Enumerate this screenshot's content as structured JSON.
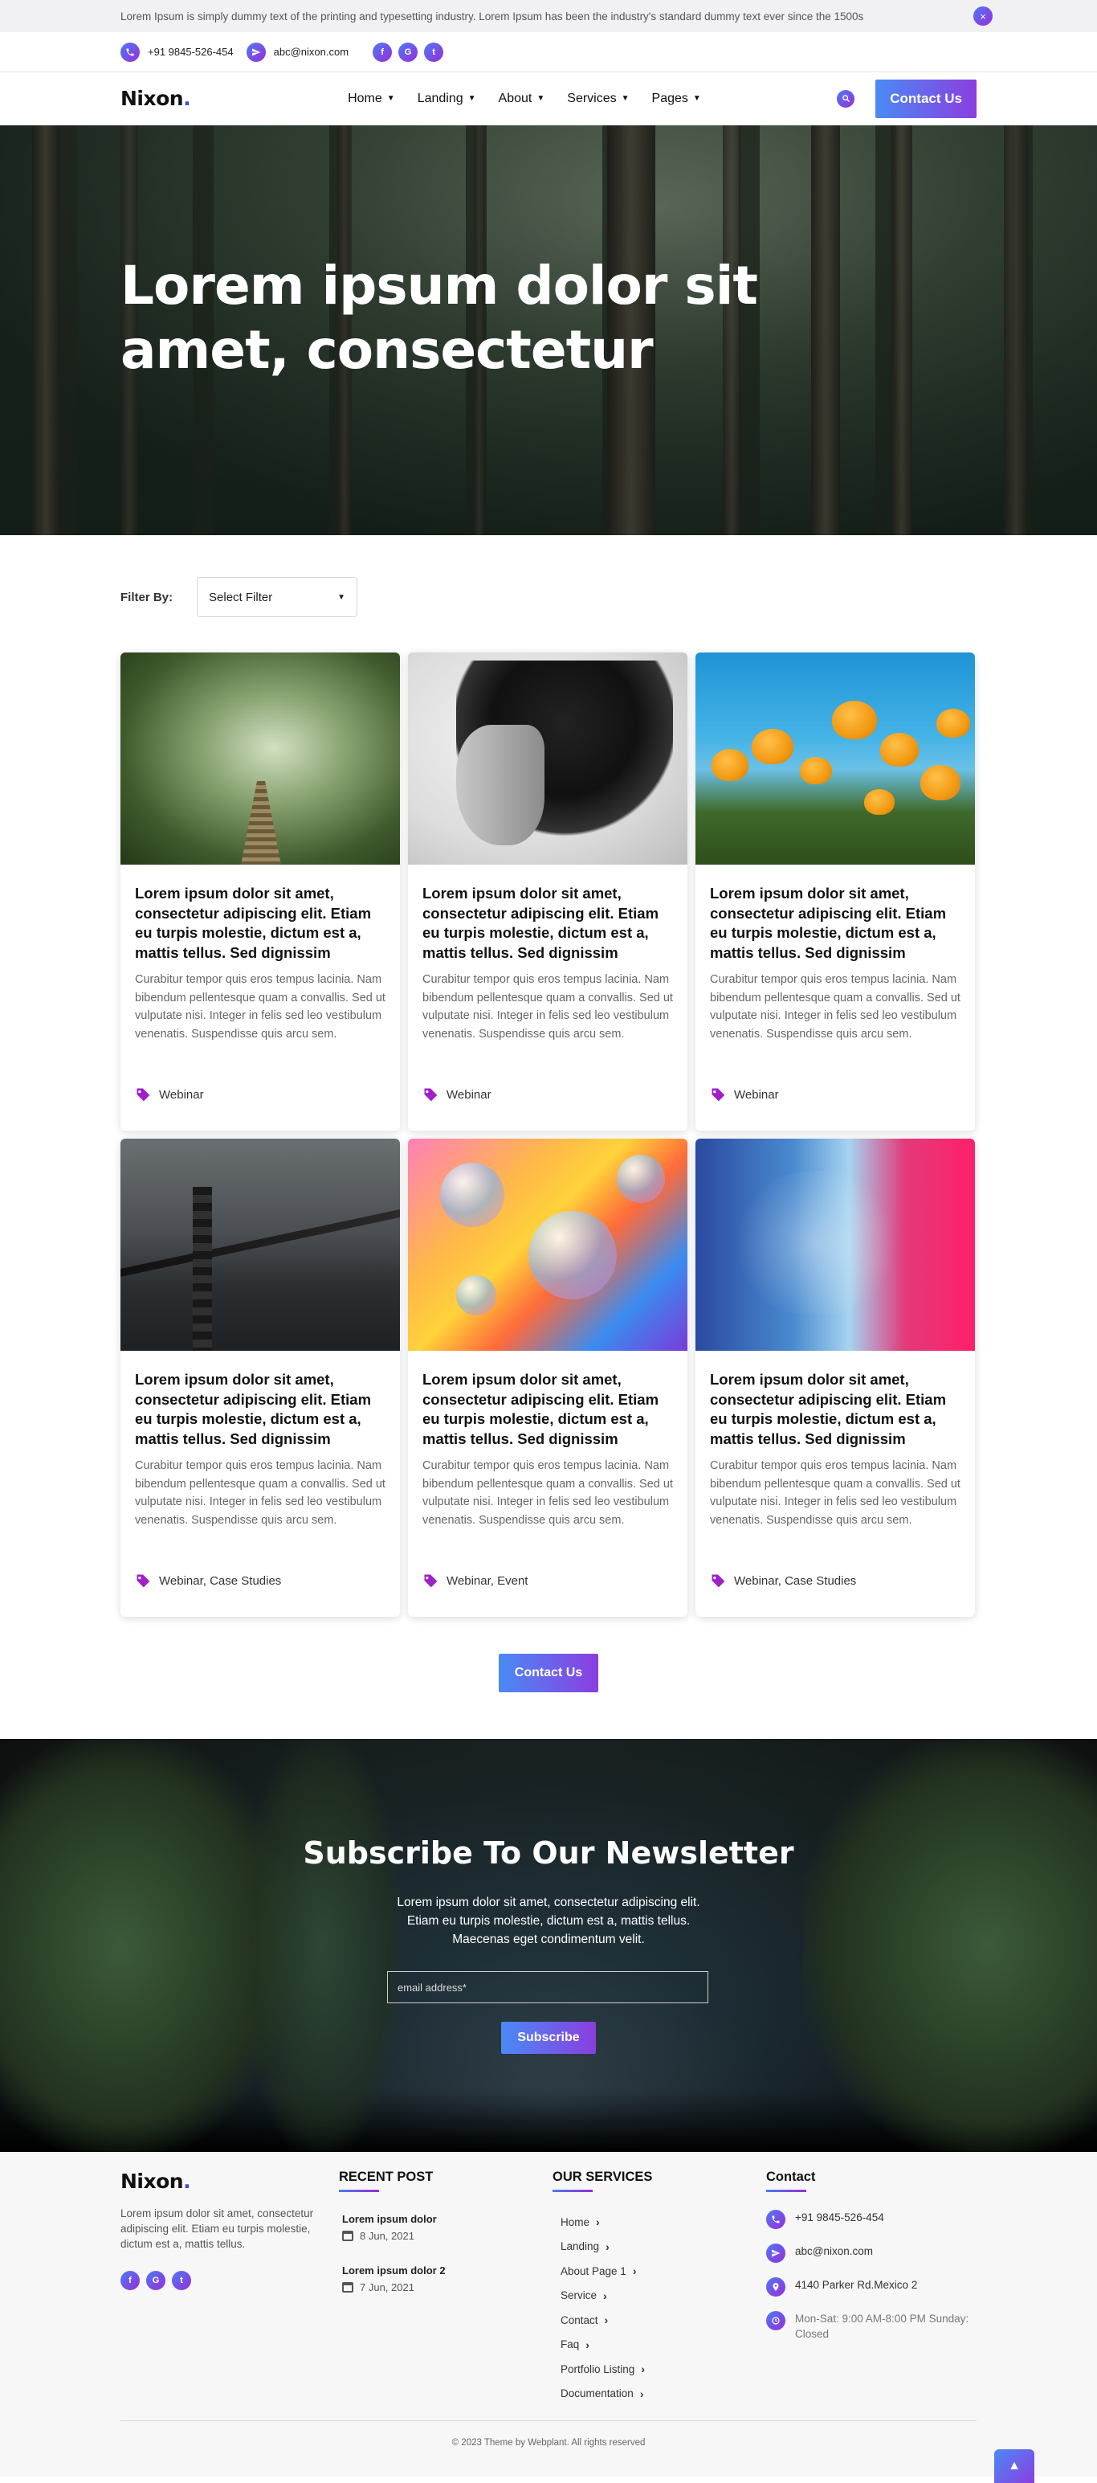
{
  "announcement": {
    "text": "Lorem Ipsum is simply dummy text of the printing and typesetting industry. Lorem Ipsum has been the industry's standard dummy text ever since the 1500s",
    "close_icon": "×"
  },
  "contact_bar": {
    "phone": "+91 9845-526-454",
    "email": "abc@nixon.com",
    "social": [
      "f",
      "G",
      "t"
    ]
  },
  "nav": {
    "logo": "Nixon",
    "logo_dot": ".",
    "items": [
      {
        "label": "Home"
      },
      {
        "label": "Landing"
      },
      {
        "label": "About"
      },
      {
        "label": "Services"
      },
      {
        "label": "Pages"
      }
    ],
    "cta": "Contact Us"
  },
  "hero": {
    "title": "Lorem ipsum dolor sit amet, consectetur"
  },
  "filter": {
    "label": "Filter By:",
    "selected": "Select Filter"
  },
  "cards": [
    {
      "title": "Lorem ipsum dolor sit amet, consectetur adipiscing elit. Etiam eu turpis molestie, dictum est a, mattis tellus. Sed dignissim",
      "text": "Curabitur tempor quis eros tempus lacinia. Nam bibendum pellentesque quam a convallis. Sed ut vulputate nisi. Integer in felis sed leo vestibulum venenatis. Suspendisse quis arcu sem.",
      "tags": "Webinar"
    },
    {
      "title": "Lorem ipsum dolor sit amet, consectetur adipiscing elit. Etiam eu turpis molestie, dictum est a, mattis tellus. Sed dignissim",
      "text": "Curabitur tempor quis eros tempus lacinia. Nam bibendum pellentesque quam a convallis. Sed ut vulputate nisi. Integer in felis sed leo vestibulum venenatis. Suspendisse quis arcu sem.",
      "tags": "Webinar"
    },
    {
      "title": "Lorem ipsum dolor sit amet, consectetur adipiscing elit. Etiam eu turpis molestie, dictum est a, mattis tellus. Sed dignissim",
      "text": "Curabitur tempor quis eros tempus lacinia. Nam bibendum pellentesque quam a convallis. Sed ut vulputate nisi. Integer in felis sed leo vestibulum venenatis. Suspendisse quis arcu sem.",
      "tags": "Webinar"
    },
    {
      "title": "Lorem ipsum dolor sit amet, consectetur adipiscing elit. Etiam eu turpis molestie, dictum est a, mattis tellus. Sed dignissim",
      "text": "Curabitur tempor quis eros tempus lacinia. Nam bibendum pellentesque quam a convallis. Sed ut vulputate nisi. Integer in felis sed leo vestibulum venenatis. Suspendisse quis arcu sem.",
      "tags": "Webinar, Case Studies"
    },
    {
      "title": "Lorem ipsum dolor sit amet, consectetur adipiscing elit. Etiam eu turpis molestie, dictum est a, mattis tellus. Sed dignissim",
      "text": "Curabitur tempor quis eros tempus lacinia. Nam bibendum pellentesque quam a convallis. Sed ut vulputate nisi. Integer in felis sed leo vestibulum venenatis. Suspendisse quis arcu sem.",
      "tags": "Webinar, Event"
    },
    {
      "title": "Lorem ipsum dolor sit amet, consectetur adipiscing elit. Etiam eu turpis molestie, dictum est a, mattis tellus. Sed dignissim",
      "text": "Curabitur tempor quis eros tempus lacinia. Nam bibendum pellentesque quam a convallis. Sed ut vulputate nisi. Integer in felis sed leo vestibulum venenatis. Suspendisse quis arcu sem.",
      "tags": "Webinar, Case Studies"
    }
  ],
  "more_cta": "Contact Us",
  "newsletter": {
    "title": "Subscribe To Our Newsletter",
    "text": "Lorem ipsum dolor sit amet, consectetur adipiscing elit. Etiam eu turpis molestie, dictum est a, mattis tellus. Maecenas eget condimentum velit.",
    "placeholder": "email address*",
    "button": "Subscribe"
  },
  "footer": {
    "logo": "Nixon",
    "logo_dot": ".",
    "about": "Lorem ipsum dolor sit amet, consectetur adipiscing elit. Etiam eu turpis molestie, dictum est a, mattis tellus.",
    "social": [
      "f",
      "G",
      "t"
    ],
    "recent_heading": "RECENT POST",
    "posts": [
      {
        "title": "Lorem ipsum dolor",
        "date": "8 Jun, 2021"
      },
      {
        "title": "Lorem ipsum dolor 2",
        "date": "7 Jun, 2021"
      }
    ],
    "services_heading": "OUR SERVICES",
    "services": [
      "Home",
      "Landing",
      "About Page 1",
      "Service",
      "Contact",
      "Faq",
      "Portfolio Listing",
      "Documentation"
    ],
    "contact_heading": "Contact",
    "contact": {
      "phone": "+91 9845-526-454",
      "email": "abc@nixon.com",
      "address": "4140 Parker Rd.Mexico 2",
      "hours": "Mon-Sat: 9:00 AM-8:00 PM Sunday: Closed"
    },
    "copyright": "© 2023 Theme by Webplant. All rights reserved"
  },
  "icons": {
    "phone": "phone-icon",
    "email": "send-icon",
    "location": "map-pin-icon",
    "clock": "clock-icon",
    "tag": "tag-icon",
    "search": "search-icon",
    "chevron": "chevron-down-icon",
    "to_top": "chevron-up-icon"
  },
  "colors": {
    "accent_start": "#4a8af5",
    "accent_end": "#8a3ee0",
    "tag_purple": "#a020c8"
  }
}
